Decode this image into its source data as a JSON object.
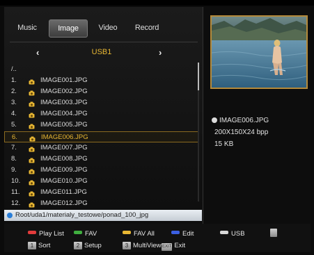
{
  "tabs": [
    {
      "label": "Music"
    },
    {
      "label": "Image"
    },
    {
      "label": "Video"
    },
    {
      "label": "Record"
    }
  ],
  "device": {
    "name": "USB1",
    "left_icon": "chevron-left-icon",
    "right_icon": "chevron-right-icon"
  },
  "files": {
    "parent": "/..",
    "items": [
      {
        "num": "1.",
        "name": "IMAGE001.JPG"
      },
      {
        "num": "2.",
        "name": "IMAGE002.JPG"
      },
      {
        "num": "3.",
        "name": "IMAGE003.JPG"
      },
      {
        "num": "4.",
        "name": "IMAGE004.JPG"
      },
      {
        "num": "5.",
        "name": "IMAGE005.JPG"
      },
      {
        "num": "6.",
        "name": "IMAGE006.JPG"
      },
      {
        "num": "7.",
        "name": "IMAGE007.JPG"
      },
      {
        "num": "8.",
        "name": "IMAGE008.JPG"
      },
      {
        "num": "9.",
        "name": "IMAGE009.JPG"
      },
      {
        "num": "10.",
        "name": "IMAGE010.JPG"
      },
      {
        "num": "11.",
        "name": "IMAGE011.JPG"
      },
      {
        "num": "12.",
        "name": "IMAGE012.JPG"
      }
    ],
    "selected_index": 5
  },
  "path": "Root/uda1/materialy_testowe/ponad_100_jpg",
  "preview": {
    "name": "IMAGE006.JPG",
    "resolution": "200X150X24 bpp",
    "size": "15 KB"
  },
  "footer": {
    "row1": [
      {
        "label": "Play List",
        "color": "#e23b3b"
      },
      {
        "label": "FAV",
        "color": "#3fae3f"
      },
      {
        "label": "FAV All",
        "color": "#e8b733"
      },
      {
        "label": "Edit",
        "color": "#3b5fe2"
      },
      {
        "label": "USB",
        "color": "#d8d8d8"
      }
    ],
    "row2": [
      {
        "key": "1",
        "label": "Sort"
      },
      {
        "key": "2",
        "label": "Setup"
      },
      {
        "key": "3",
        "label": "MultiView"
      },
      {
        "key": "EXIT",
        "label": "Exit"
      }
    ]
  },
  "colors": {
    "accent": "#e8b733",
    "selection_border": "#8a6a20",
    "path_bg": "#dfe5eb"
  }
}
